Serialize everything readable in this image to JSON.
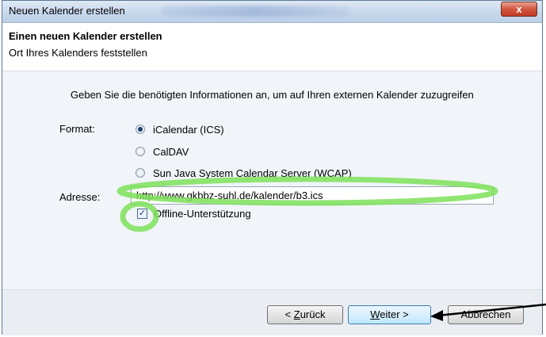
{
  "window": {
    "title": "Neuen Kalender erstellen",
    "close_glyph": "x"
  },
  "header": {
    "title": "Einen neuen Kalender erstellen",
    "subtitle": "Ort Ihres Kalenders feststellen"
  },
  "content": {
    "intro": "Geben Sie die benötigten Informationen an, um auf Ihren externen Kalender zuzugreifen",
    "format_label": "Format:",
    "formats": [
      {
        "label": "iCalendar (ICS)",
        "checked": true
      },
      {
        "label": "CalDAV",
        "checked": false
      },
      {
        "label": "Sun Java System Calendar Server (WCAP)",
        "checked": false
      }
    ],
    "address_label": "Adresse:",
    "address_value": "http://www.gkbbz-suhl.de/kalender/b3.ics",
    "offline_label": "Offline-Unterstützung",
    "offline_checked": true,
    "checkmark": "✓"
  },
  "footer": {
    "back": {
      "underline": "Z",
      "rest": "urück",
      "prefix": "< "
    },
    "next": {
      "underline": "W",
      "rest": "eiter >",
      "prefix": ""
    },
    "cancel": "Abbrechen"
  },
  "colors": {
    "highlight": "#7ee05a",
    "arrow": "#000000",
    "accent": "#3c7fb1"
  }
}
